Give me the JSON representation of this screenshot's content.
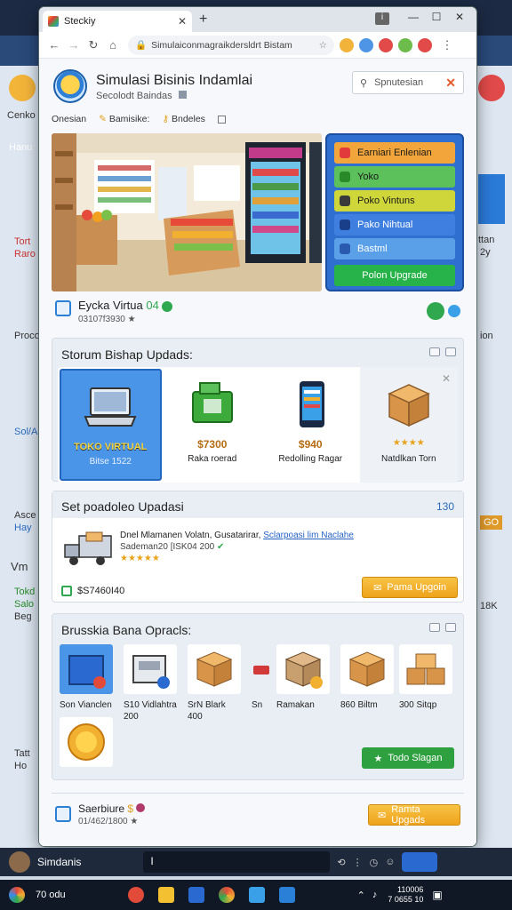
{
  "browser": {
    "tab_title": "Steckiy",
    "url": "Simulaiconmagraikdersldrt Bistam",
    "new_tab_symbol": "+",
    "close_symbol": "✕"
  },
  "site": {
    "title": "Simulasi Bisinis Indamlai",
    "subtitle": "Secolodt Baindas",
    "links": [
      "Onesian",
      "Bamisike:",
      "Bndeles"
    ],
    "search_placeholder": "Spnutesian"
  },
  "hero_menu": {
    "items": [
      {
        "label": "Earniari Enlenian",
        "color": "#f2a53a"
      },
      {
        "label": "Yoko",
        "color": "#5cc15a"
      },
      {
        "label": "Poko Vintuns",
        "color": "#cfd63a"
      },
      {
        "label": "Pako Nihtual",
        "color": "#3f7fe0"
      },
      {
        "label": "Bastml",
        "color": "#5aa0e8"
      }
    ],
    "upgrade_label": "Polon Upgrade"
  },
  "store": {
    "name": "Eycka Virtua",
    "level": "04",
    "meta": "03107f3930"
  },
  "upgrade_panel": {
    "title": "Storum Bishap Updads:",
    "cards": [
      {
        "title": "TOKO VIRTUAL",
        "sub": "Bitse 1522",
        "selected": true
      },
      {
        "price": "$7300",
        "label": "Raka roerad"
      },
      {
        "price": "$940",
        "label": "Redolling Ragar"
      },
      {
        "stars": "★★★★",
        "label": "Natdlkan Torn"
      }
    ]
  },
  "updates_panel": {
    "title": "Set poadoleo Upadasi",
    "count": "130",
    "desc": "Dnel Mlamanen Volatn, Gusatarirar,",
    "link": "Sclarpoasi lim Naclahe",
    "meta": "Sademan20 [ISK04 200",
    "stars": "★★★★★",
    "price": "$S7460I40",
    "button": "Pama Upgoin"
  },
  "products_panel": {
    "title": "Brusskia Bana Opracls:",
    "items": [
      {
        "label": "Son Vianclen"
      },
      {
        "label": "S10 Vidlahtra 200"
      },
      {
        "label": "SrN Blark 400"
      },
      {
        "label": "Sn"
      },
      {
        "label": "Ramakan"
      },
      {
        "label": "860 Biltm"
      },
      {
        "label": "300 Sitqp"
      },
      {
        "label": ""
      }
    ],
    "button": "Todo Slagan"
  },
  "footer_store": {
    "name": "Saerbiure",
    "meta": "01/462/1800",
    "button": "Ramta Upgads"
  },
  "appbar": {
    "user": "Simdanis",
    "cursor": "I"
  },
  "taskbar": {
    "weather": "70 odu",
    "time": "110006",
    "date": "7 0655 10"
  },
  "background": {
    "left_texts": [
      "Cenko",
      "Hanu",
      "Tort",
      "Raro",
      "Proco",
      "Sol/A",
      "Asce",
      "Hay",
      "Vm",
      "Tokd",
      "Salo",
      "Beg",
      "Tatt",
      "Ho"
    ],
    "right_texts": [
      "ttan",
      "2y",
      "ion",
      "18K",
      "GO"
    ]
  }
}
